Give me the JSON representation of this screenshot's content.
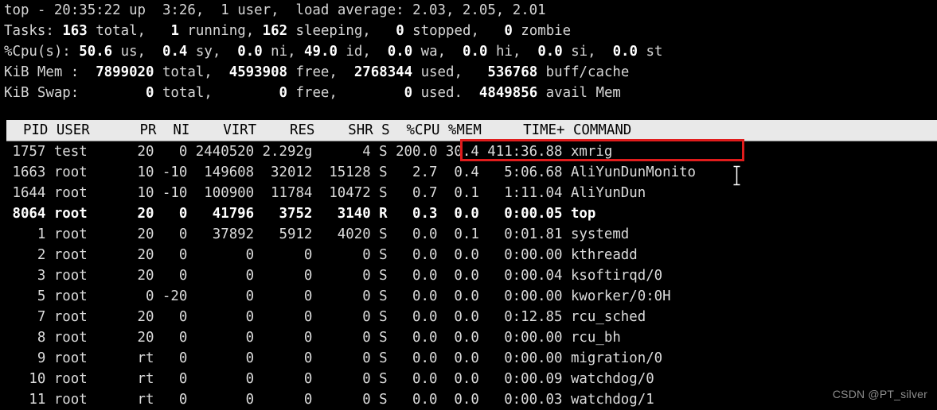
{
  "terminal": {
    "title": "top",
    "colors": {
      "background": "#000000",
      "foreground": "#dcdcdc",
      "header_bar_background": "#e9e9e9",
      "header_bar_foreground": "#000000",
      "annotation_red": "#e01c1c",
      "watermark": "#8d8d8d"
    }
  },
  "summary": {
    "uptime_line": {
      "prefix": "top - ",
      "time": "20:35:22",
      "up_label": " up ",
      "uptime": " 3:26,",
      "users": "  1 user,",
      "load_label": "  load average: ",
      "load_1": "2.03,",
      "load_5": " 2.05,",
      "load_15": " 2.01"
    },
    "tasks_line": {
      "label": "Tasks:",
      "total": "163",
      "total_label": " total,",
      "running": "1",
      "running_label": " running,",
      "sleeping": "162",
      "sleeping_label": " sleeping,",
      "stopped": "0",
      "stopped_label": " stopped,",
      "zombie": "0",
      "zombie_label": " zombie"
    },
    "cpu_line": {
      "label": "%Cpu(s):",
      "us": "50.6",
      "us_label": " us,",
      "sy": "0.4",
      "sy_label": " sy,",
      "ni": "0.0",
      "ni_label": " ni,",
      "id": "49.0",
      "id_label": " id,",
      "wa": "0.0",
      "wa_label": " wa,",
      "hi": "0.0",
      "hi_label": " hi,",
      "si": "0.0",
      "si_label": " si,",
      "st": "0.0",
      "st_label": " st"
    },
    "mem_line": {
      "label": "KiB Mem :",
      "total": "7899020",
      "total_label": " total,",
      "free": "4593908",
      "free_label": " free,",
      "used": "2768344",
      "used_label": " used,",
      "buffcache": "536768",
      "buffcache_label": " buff/cache"
    },
    "swap_line": {
      "label": "KiB Swap:",
      "total": "0",
      "total_label": " total,",
      "free": "0",
      "free_label": " free,",
      "used": "0",
      "used_label": " used.",
      "avail": "4849856",
      "avail_label": " avail Mem"
    }
  },
  "table": {
    "header_text": "  PID USER      PR  NI    VIRT    RES    SHR S  %CPU %MEM     TIME+ COMMAND                                                ",
    "columns": [
      "PID",
      "USER",
      "PR",
      "NI",
      "VIRT",
      "RES",
      "SHR",
      "S",
      "%CPU",
      "%MEM",
      "TIME+",
      "COMMAND"
    ],
    "rows": [
      {
        "text": " 1757 test      20   0 2440520 2.292g      4 S 200.0 30.4 411:36.88 xmrig",
        "bold": false,
        "pid": "1757",
        "user": "test",
        "pr": "20",
        "ni": "0",
        "virt": "2440520",
        "res": "2.292g",
        "shr": "4",
        "s": "S",
        "cpu": "200.0",
        "mem": "30.4",
        "time": "411:36.88",
        "command": "xmrig"
      },
      {
        "text": " 1663 root      10 -10  149608  32012  15128 S   2.7  0.4   5:06.68 AliYunDunMonito",
        "bold": false,
        "pid": "1663",
        "user": "root",
        "pr": "10",
        "ni": "-10",
        "virt": "149608",
        "res": "32012",
        "shr": "15128",
        "s": "S",
        "cpu": "2.7",
        "mem": "0.4",
        "time": "5:06.68",
        "command": "AliYunDunMonito"
      },
      {
        "text": " 1644 root      10 -10  100900  11784  10472 S   0.7  0.1   1:11.04 AliYunDun",
        "bold": false,
        "pid": "1644",
        "user": "root",
        "pr": "10",
        "ni": "-10",
        "virt": "100900",
        "res": "11784",
        "shr": "10472",
        "s": "S",
        "cpu": "0.7",
        "mem": "0.1",
        "time": "1:11.04",
        "command": "AliYunDun"
      },
      {
        "text": " 8064 root      20   0   41796   3752   3140 R   0.3  0.0   0:00.05 top",
        "bold": true,
        "pid": "8064",
        "user": "root",
        "pr": "20",
        "ni": "0",
        "virt": "41796",
        "res": "3752",
        "shr": "3140",
        "s": "R",
        "cpu": "0.3",
        "mem": "0.0",
        "time": "0:00.05",
        "command": "top"
      },
      {
        "text": "    1 root      20   0   37892   5912   4020 S   0.0  0.1   0:01.81 systemd",
        "bold": false,
        "pid": "1",
        "user": "root",
        "pr": "20",
        "ni": "0",
        "virt": "37892",
        "res": "5912",
        "shr": "4020",
        "s": "S",
        "cpu": "0.0",
        "mem": "0.1",
        "time": "0:01.81",
        "command": "systemd"
      },
      {
        "text": "    2 root      20   0       0      0      0 S   0.0  0.0   0:00.00 kthreadd",
        "bold": false,
        "pid": "2",
        "user": "root",
        "pr": "20",
        "ni": "0",
        "virt": "0",
        "res": "0",
        "shr": "0",
        "s": "S",
        "cpu": "0.0",
        "mem": "0.0",
        "time": "0:00.00",
        "command": "kthreadd"
      },
      {
        "text": "    3 root      20   0       0      0      0 S   0.0  0.0   0:00.04 ksoftirqd/0",
        "bold": false,
        "pid": "3",
        "user": "root",
        "pr": "20",
        "ni": "0",
        "virt": "0",
        "res": "0",
        "shr": "0",
        "s": "S",
        "cpu": "0.0",
        "mem": "0.0",
        "time": "0:00.04",
        "command": "ksoftirqd/0"
      },
      {
        "text": "    5 root       0 -20       0      0      0 S   0.0  0.0   0:00.00 kworker/0:0H",
        "bold": false,
        "pid": "5",
        "user": "root",
        "pr": "0",
        "ni": "-20",
        "virt": "0",
        "res": "0",
        "shr": "0",
        "s": "S",
        "cpu": "0.0",
        "mem": "0.0",
        "time": "0:00.00",
        "command": "kworker/0:0H"
      },
      {
        "text": "    7 root      20   0       0      0      0 S   0.0  0.0   0:12.85 rcu_sched",
        "bold": false,
        "pid": "7",
        "user": "root",
        "pr": "20",
        "ni": "0",
        "virt": "0",
        "res": "0",
        "shr": "0",
        "s": "S",
        "cpu": "0.0",
        "mem": "0.0",
        "time": "0:12.85",
        "command": "rcu_sched"
      },
      {
        "text": "    8 root      20   0       0      0      0 S   0.0  0.0   0:00.00 rcu_bh",
        "bold": false,
        "pid": "8",
        "user": "root",
        "pr": "20",
        "ni": "0",
        "virt": "0",
        "res": "0",
        "shr": "0",
        "s": "S",
        "cpu": "0.0",
        "mem": "0.0",
        "time": "0:00.00",
        "command": "rcu_bh"
      },
      {
        "text": "    9 root      rt   0       0      0      0 S   0.0  0.0   0:00.00 migration/0",
        "bold": false,
        "pid": "9",
        "user": "root",
        "pr": "rt",
        "ni": "0",
        "virt": "0",
        "res": "0",
        "shr": "0",
        "s": "S",
        "cpu": "0.0",
        "mem": "0.0",
        "time": "0:00.00",
        "command": "migration/0"
      },
      {
        "text": "   10 root      rt   0       0      0      0 S   0.0  0.0   0:00.09 watchdog/0",
        "bold": false,
        "pid": "10",
        "user": "root",
        "pr": "rt",
        "ni": "0",
        "virt": "0",
        "res": "0",
        "shr": "0",
        "s": "S",
        "cpu": "0.0",
        "mem": "0.0",
        "time": "0:00.09",
        "command": "watchdog/0"
      },
      {
        "text": "   11 root      rt   0       0      0      0 S   0.0  0.0   0:00.03 watchdog/1",
        "bold": false,
        "pid": "11",
        "user": "root",
        "pr": "rt",
        "ni": "0",
        "virt": "0",
        "res": "0",
        "shr": "0",
        "s": "S",
        "cpu": "0.0",
        "mem": "0.0",
        "time": "0:00.03",
        "command": "watchdog/1"
      }
    ]
  },
  "annotation": {
    "highlight_target": "200.0 30.4 411:36.88 xmrig",
    "color": "#e01c1c"
  },
  "watermark": {
    "text": "CSDN @PT_silver"
  }
}
